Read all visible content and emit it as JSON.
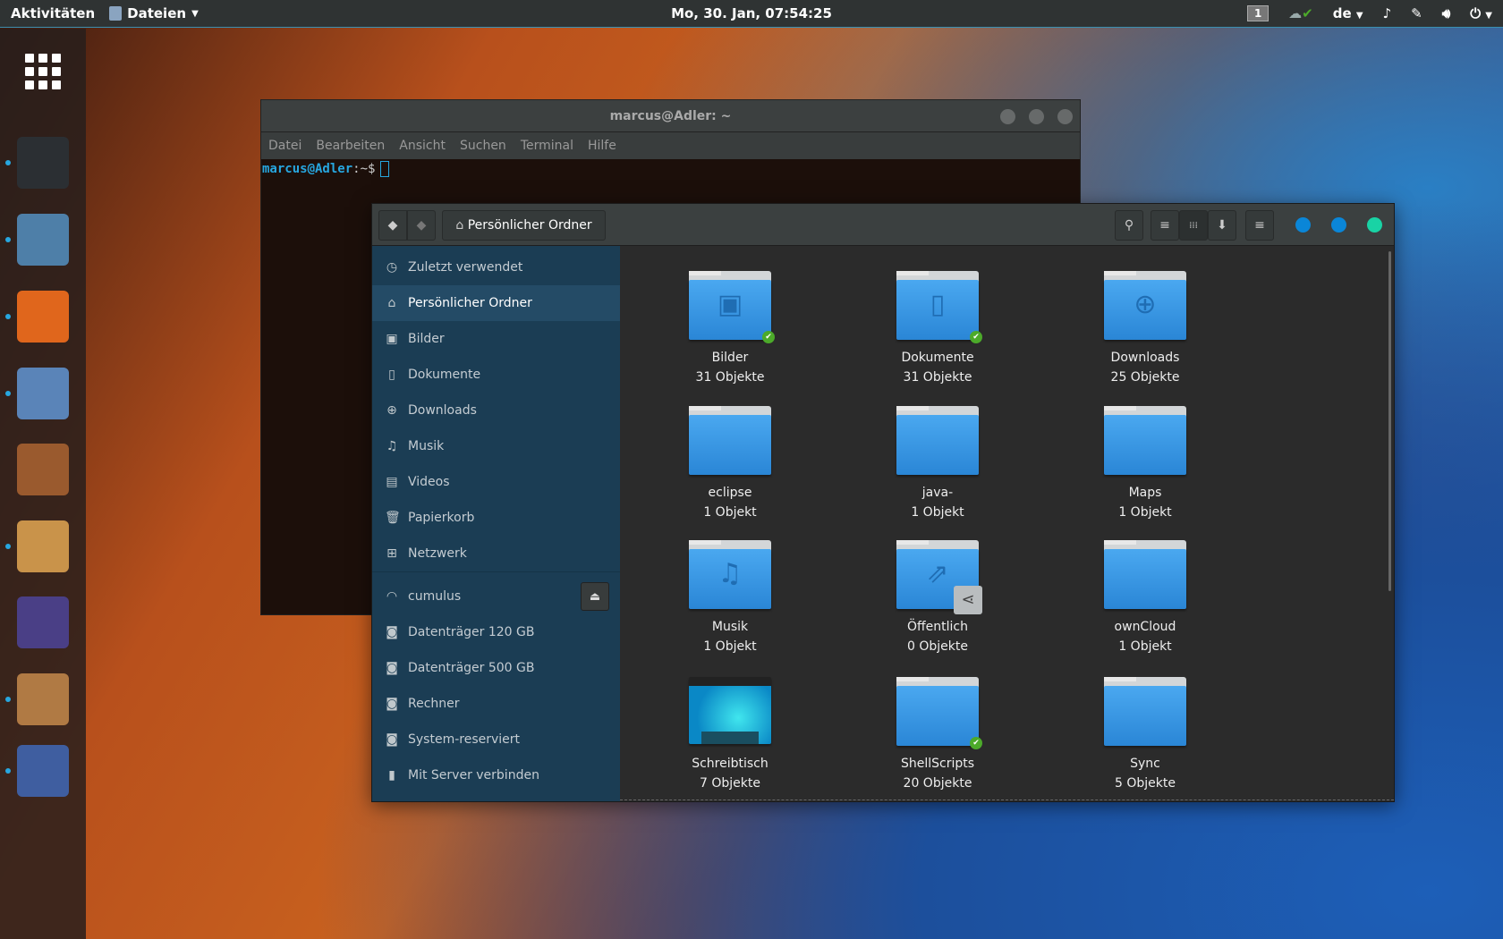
{
  "topbar": {
    "activities": "Aktivitäten",
    "app_menu": "Dateien",
    "clock": "Mo, 30. Jan, 07:54:25",
    "workspace": "1",
    "keyboard": "de"
  },
  "dock": {
    "apps": [
      "terminal",
      "files",
      "firefox",
      "thunderbird",
      "wallet",
      "gimp",
      "eclipse",
      "speaker",
      "arabic-app"
    ]
  },
  "terminal": {
    "title": "marcus@Adler: ~",
    "menu": [
      "Datei",
      "Bearbeiten",
      "Ansicht",
      "Suchen",
      "Terminal",
      "Hilfe"
    ],
    "prompt": "marcus@Adler",
    "prompt_suffix": ":~$"
  },
  "files": {
    "location": "Persönlicher Ordner",
    "colors": {
      "accent": "#0a86d8",
      "close": "#19d3a5",
      "sidebar": "#1b3d54"
    },
    "sidebar": [
      {
        "label": "Zuletzt verwendet",
        "icon": "clock-icon",
        "glyph": "◷"
      },
      {
        "label": "Persönlicher Ordner",
        "icon": "home-icon",
        "glyph": "⌂",
        "selected": true
      },
      {
        "label": "Bilder",
        "icon": "image-icon",
        "glyph": "▣"
      },
      {
        "label": "Dokumente",
        "icon": "document-icon",
        "glyph": "▯"
      },
      {
        "label": "Downloads",
        "icon": "download-icon",
        "glyph": "⊕"
      },
      {
        "label": "Musik",
        "icon": "music-icon",
        "glyph": "♫"
      },
      {
        "label": "Videos",
        "icon": "film-icon",
        "glyph": "▤"
      },
      {
        "label": "Papierkorb",
        "icon": "trash-icon",
        "glyph": "🗑"
      },
      {
        "label": "Netzwerk",
        "icon": "network-icon",
        "glyph": "⊞"
      }
    ],
    "devices": [
      {
        "label": "cumulus",
        "icon": "wifi-icon",
        "glyph": "◠",
        "eject": true
      },
      {
        "label": "Datenträger 120 GB",
        "icon": "disk-icon",
        "glyph": "◙"
      },
      {
        "label": "Datenträger 500 GB",
        "icon": "disk-icon",
        "glyph": "◙"
      },
      {
        "label": "Rechner",
        "icon": "disk-icon",
        "glyph": "◙"
      },
      {
        "label": "System-reserviert",
        "icon": "disk-icon",
        "glyph": "◙"
      },
      {
        "label": "Mit Server verbinden",
        "icon": "server-icon",
        "glyph": "▮"
      }
    ],
    "items": [
      {
        "name": "Bilder",
        "count": "31 Objekte",
        "glyph": "▣",
        "synced": true
      },
      {
        "name": "Dokumente",
        "count": "31 Objekte",
        "glyph": "▯",
        "synced": true
      },
      {
        "name": "Downloads",
        "count": "25 Objekte",
        "glyph": "⊕"
      },
      {
        "name": "eclipse",
        "count": "1 Objekt"
      },
      {
        "name": "java-",
        "count": "1 Objekt"
      },
      {
        "name": "Maps",
        "count": "1 Objekt"
      },
      {
        "name": "Musik",
        "count": "1 Objekt",
        "glyph": "♫"
      },
      {
        "name": "Öffentlich",
        "count": "0 Objekte",
        "glyph": "⇗",
        "shared": true
      },
      {
        "name": "ownCloud",
        "count": "1 Objekt"
      },
      {
        "name": "Schreibtisch",
        "count": "7 Objekte",
        "desktop": true
      },
      {
        "name": "ShellScripts",
        "count": "20 Objekte",
        "synced": true
      },
      {
        "name": "Sync",
        "count": "5 Objekte"
      }
    ]
  }
}
